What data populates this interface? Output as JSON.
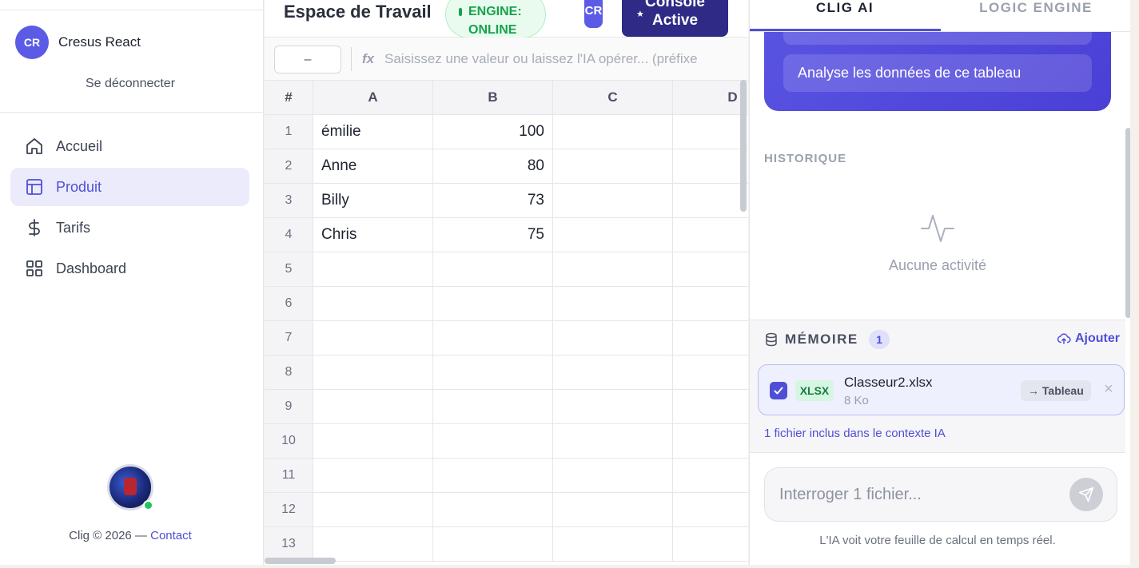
{
  "sidebar": {
    "user": {
      "initials": "CR",
      "name": "Cresus React"
    },
    "logout": "Se déconnecter",
    "nav": [
      {
        "label": "Accueil",
        "icon": "home-icon",
        "active": false
      },
      {
        "label": "Produit",
        "icon": "layout-icon",
        "active": true
      },
      {
        "label": "Tarifs",
        "icon": "dollar-icon",
        "active": false
      },
      {
        "label": "Dashboard",
        "icon": "grid-icon",
        "active": false
      }
    ],
    "footer": {
      "text": "Clig © 2026 — ",
      "link": "Contact"
    }
  },
  "workspace": {
    "title": "Espace de Travail",
    "engine_status": "ENGINE: ONLINE",
    "user_badge": "CR",
    "console_button": "Console Active",
    "formula": {
      "cell_ref": "–",
      "fx": "fx",
      "placeholder": "Saisissez une valeur ou laissez l'IA opérer... (préfixe"
    },
    "columns": [
      "#",
      "A",
      "B",
      "C",
      "D"
    ],
    "rows": [
      {
        "n": "1",
        "A": "émilie",
        "B": "100"
      },
      {
        "n": "2",
        "A": "Anne",
        "B": "80"
      },
      {
        "n": "3",
        "A": "Billy",
        "B": "73"
      },
      {
        "n": "4",
        "A": "Chris",
        "B": "75"
      },
      {
        "n": "5",
        "A": "",
        "B": ""
      },
      {
        "n": "6",
        "A": "",
        "B": ""
      },
      {
        "n": "7",
        "A": "",
        "B": ""
      },
      {
        "n": "8",
        "A": "",
        "B": ""
      },
      {
        "n": "9",
        "A": "",
        "B": ""
      },
      {
        "n": "10",
        "A": "",
        "B": ""
      },
      {
        "n": "11",
        "A": "",
        "B": ""
      },
      {
        "n": "12",
        "A": "",
        "B": ""
      },
      {
        "n": "13",
        "A": "",
        "B": ""
      }
    ]
  },
  "panel": {
    "tabs": [
      "CLIG AI",
      "LOGIC ENGINE"
    ],
    "suggestions": [
      "",
      "Analyse les données de ce tableau"
    ],
    "history_label": "HISTORIQUE",
    "no_activity": "Aucune activité",
    "memory": {
      "title": "MÉMOIRE",
      "count": "1",
      "add_label": "Ajouter",
      "file": {
        "type": "XLSX",
        "name": "Classeur2.xlsx",
        "size": "8 Ko",
        "action": "→ Tableau"
      },
      "context_note": "1 fichier inclus dans le contexte IA"
    },
    "input_placeholder": "Interroger 1 fichier...",
    "realtime_note": "L'IA voit votre feuille de calcul en temps réel."
  },
  "colors": {
    "accent": "#4f4fd6",
    "online": "#16a34a",
    "console": "#2e2a86",
    "ai_card": "#5b56e3"
  }
}
